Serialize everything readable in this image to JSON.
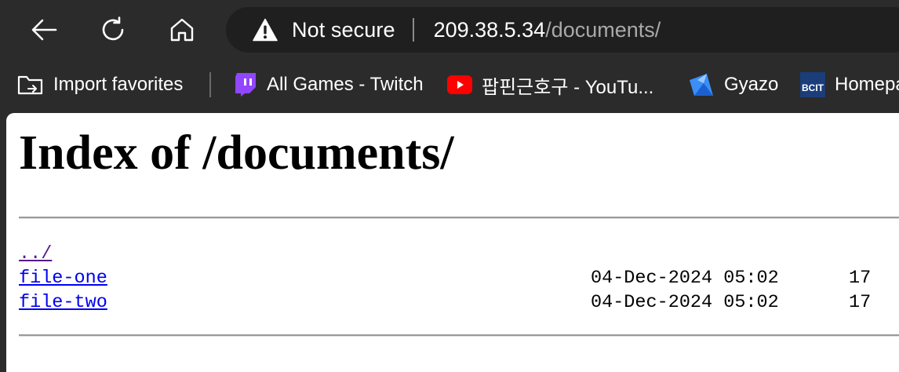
{
  "toolbar": {
    "back_icon": "back-arrow-icon",
    "refresh_icon": "refresh-icon",
    "home_icon": "home-icon"
  },
  "address_bar": {
    "security_label": "Not secure",
    "security_icon": "warning-triangle-icon",
    "url_host": "209.38.5.34",
    "url_path": "/documents/"
  },
  "bookmarks": [
    {
      "label": "Import favorites",
      "icon": "folder-import-icon"
    },
    {
      "label": "All Games - Twitch",
      "icon": "twitch-icon"
    },
    {
      "label": "팝핀근호구 - YouTu...",
      "icon": "youtube-icon"
    },
    {
      "label": "Gyazo",
      "icon": "gyazo-icon"
    },
    {
      "label": "Homepa",
      "icon": "bcit-icon"
    }
  ],
  "page": {
    "title": "Index of /documents/",
    "entries": [
      {
        "name": "../",
        "date": "",
        "size": ""
      },
      {
        "name": "file-one",
        "date": "04-Dec-2024 05:02",
        "size": "17"
      },
      {
        "name": "file-two",
        "date": "04-Dec-2024 05:02",
        "size": "17"
      }
    ]
  },
  "colors": {
    "chrome_bg": "#2b2b2b",
    "address_bg": "#1f1f1f",
    "link": "#0000ee",
    "visited_link": "#551a8b",
    "twitch": "#9146ff",
    "youtube": "#ff0000",
    "gyazo": "#3a8ef6",
    "bcit": "#1b3d7a"
  }
}
